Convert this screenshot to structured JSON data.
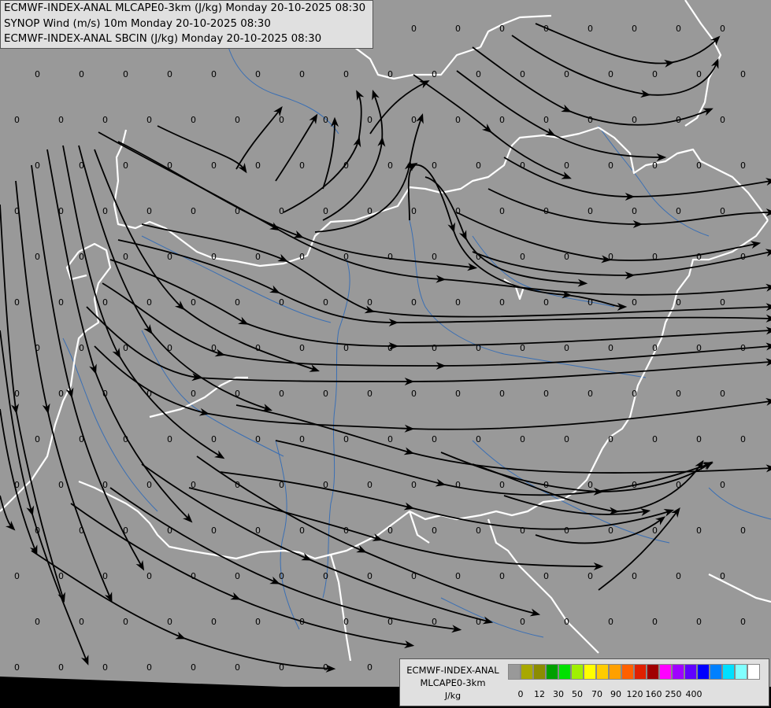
{
  "header": {
    "line1": "ECMWF-INDEX-ANAL MLCAPE0-3km (J/kg) Monday 20-10-2025 08:30",
    "line2": "SYNOP Wind (m/s) 10m Monday 20-10-2025 08:30",
    "line3": "ECMWF-INDEX-ANAL SBCIN (J/kg) Monday 20-10-2025 08:30"
  },
  "map": {
    "background_color": "#999999",
    "border_color": "#ffffff",
    "river_color": "#3a6fb4",
    "streamline_color": "#000000",
    "station_value": "0"
  },
  "legend": {
    "title_line1": "ECMWF-INDEX-ANAL",
    "title_line2": "MLCAPE0-3km",
    "unit": "J/kg",
    "colors": [
      "#999999",
      "#a8a800",
      "#8c8c00",
      "#00a000",
      "#00e000",
      "#a0f000",
      "#ffff00",
      "#ffcc00",
      "#ffa000",
      "#ff6000",
      "#e02000",
      "#a00000",
      "#ff00ff",
      "#a000ff",
      "#6000ff",
      "#0000ff",
      "#0080ff",
      "#00e0ff",
      "#80ffff",
      "#ffffff"
    ],
    "ticks": [
      "0",
      "12",
      "30",
      "50",
      "70",
      "90",
      "120",
      "160",
      "250",
      "400"
    ]
  }
}
